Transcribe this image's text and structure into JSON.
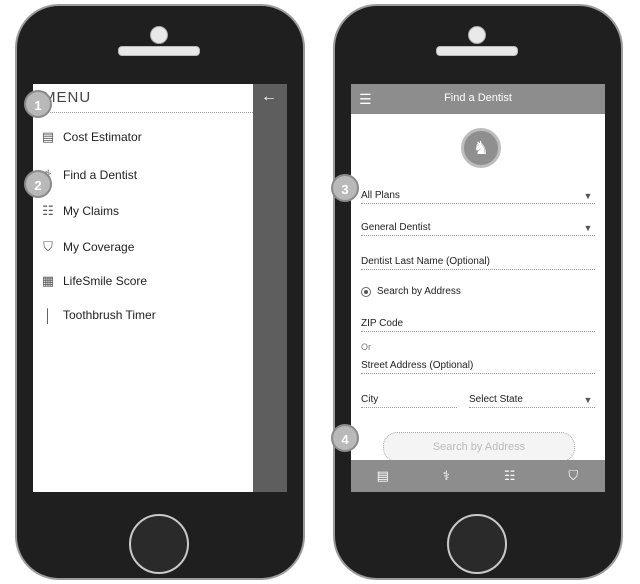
{
  "left_screen": {
    "menu_title": "MENU",
    "back_icon": "arrow-left-icon",
    "items": [
      {
        "label": "Cost Estimator",
        "icon": "calculator-icon"
      },
      {
        "label": "Find a Dentist",
        "icon": "dentist-icon"
      },
      {
        "label": "My Claims",
        "icon": "claims-icon"
      },
      {
        "label": "My Coverage",
        "icon": "shield-icon"
      },
      {
        "label": "LifeSmile Score",
        "icon": "score-icon"
      },
      {
        "label": "Toothbrush Timer",
        "icon": "toothbrush-icon"
      }
    ]
  },
  "right_screen": {
    "title": "Find a Dentist",
    "plan_field": "All Plans",
    "specialty_field": "General Dentist",
    "last_name_field": "Dentist Last Name (Optional)",
    "search_by_label": "Search by Address",
    "zip_field": "ZIP Code",
    "or_label": "Or",
    "street_field": "Street Address (Optional)",
    "city_field": "City",
    "state_field": "Select State",
    "search_button": "Search by Address"
  },
  "callouts": [
    "1",
    "2",
    "3",
    "4"
  ],
  "colors": {
    "bar_gray": "#8d8d8d",
    "overlay_gray": "#5e5e5e",
    "phone_black": "#1f1f1f",
    "badge_gray": "#b9b9b9"
  }
}
